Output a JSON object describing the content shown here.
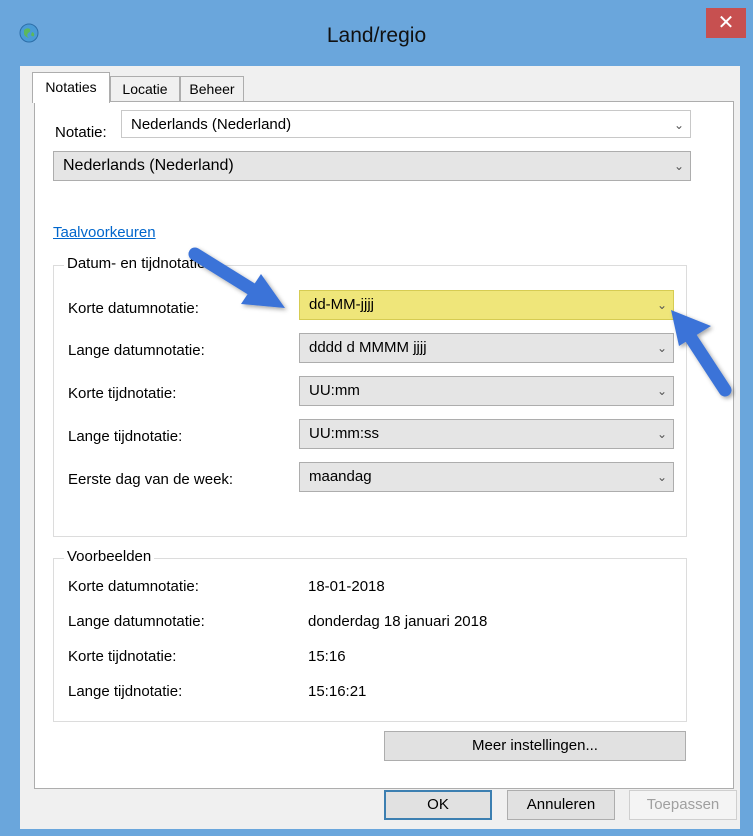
{
  "window": {
    "title": "Land/regio",
    "close_glyph": "✕",
    "app_icon": "globe-icon"
  },
  "tabs": [
    {
      "label": "Notaties",
      "active": true
    },
    {
      "label": "Locatie",
      "active": false
    },
    {
      "label": "Beheer",
      "active": false
    }
  ],
  "format": {
    "label": "Notatie:",
    "small_value": "Nederlands (Nederland)",
    "large_value": "Nederlands (Nederland)"
  },
  "language_link": "Taalvoorkeuren",
  "datetime_group": {
    "title": "Datum- en tijdnotaties",
    "rows": [
      {
        "label": "Korte datumnotatie:",
        "value": "dd-MM-jjjj"
      },
      {
        "label": "Lange datumnotatie:",
        "value": "dddd d MMMM jjjj"
      },
      {
        "label": "Korte tijdnotatie:",
        "value": "UU:mm"
      },
      {
        "label": "Lange tijdnotatie:",
        "value": "UU:mm:ss"
      },
      {
        "label": "Eerste dag van de week:",
        "value": "maandag"
      }
    ]
  },
  "examples": {
    "title": "Voorbeelden",
    "rows": [
      {
        "label": "Korte datumnotatie:",
        "value": "18-01-2018"
      },
      {
        "label": "Lange datumnotatie:",
        "value": "donderdag 18 januari 2018"
      },
      {
        "label": "Korte tijdnotatie:",
        "value": "15:16"
      },
      {
        "label": "Lange tijdnotatie:",
        "value": "15:16:21"
      }
    ]
  },
  "buttons": {
    "more": "Meer instellingen...",
    "ok": "OK",
    "cancel": "Annuleren",
    "apply": "Toepassen"
  },
  "dropdown_glyph": "⌄",
  "colors": {
    "highlight": "#efe67a",
    "arrow": "#3b73d8",
    "titlebar": "#6aa6dc",
    "close": "#c75050"
  }
}
